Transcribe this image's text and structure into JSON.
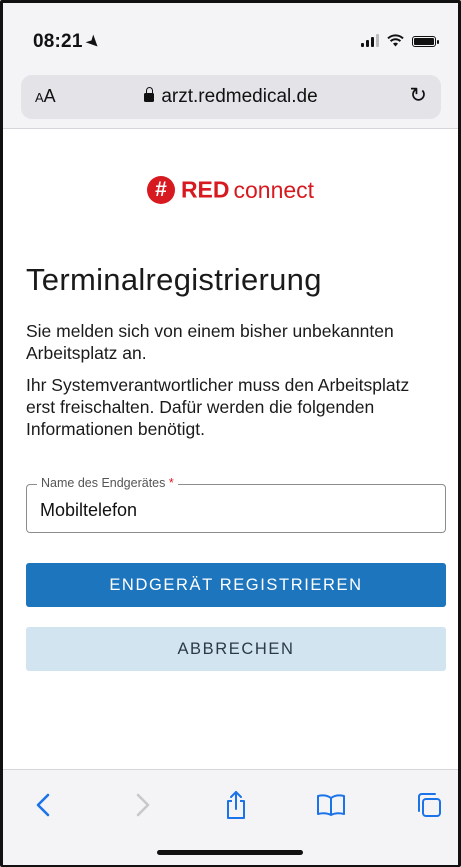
{
  "status_bar": {
    "time": "08:21",
    "location_icon": "location-arrow-icon"
  },
  "address_bar": {
    "aa_label_small": "A",
    "aa_label_large": "A",
    "url": "arzt.redmedical.de",
    "lock_icon": "lock-icon",
    "reload_icon": "reload-icon"
  },
  "logo": {
    "hash": "#",
    "red": "RED",
    "connect": "connect",
    "brand_color": "#d71920"
  },
  "page": {
    "title": "Terminalregistrierung",
    "para1": "Sie melden sich von einem bisher unbekannten Arbeitsplatz an.",
    "para2": "Ihr Systemverantwortlicher muss den Arbeitsplatz erst freischalten. Dafür werden die folgenden Informationen benötigt."
  },
  "form": {
    "device_name_label": "Name des Endgerätes",
    "required_marker": "*",
    "device_name_value": "Mobiltelefon"
  },
  "buttons": {
    "register_label": "ENDGERÄT REGISTRIEREN",
    "cancel_label": "ABBRECHEN",
    "primary_color": "#1d75bd",
    "secondary_color": "#d3e4f1"
  },
  "toolbar": {
    "icons": [
      "back-icon",
      "forward-icon",
      "share-icon",
      "bookmarks-icon",
      "tabs-icon"
    ]
  }
}
